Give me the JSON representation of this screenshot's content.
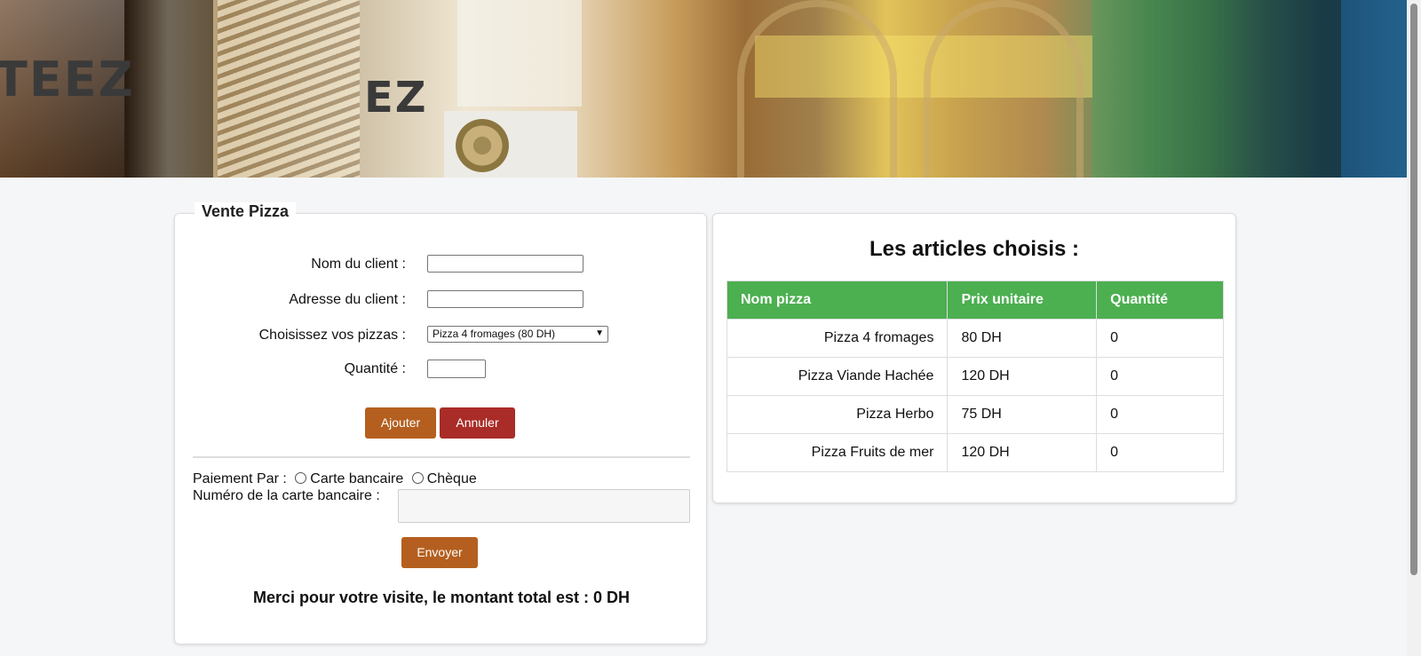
{
  "form": {
    "legend": "Vente Pizza",
    "client_name_label": "Nom du client :",
    "client_name_value": "",
    "client_address_label": "Adresse du client :",
    "client_address_value": "",
    "pizza_select_label": "Choisissez vos pizzas :",
    "pizza_select_value": "Pizza 4 fromages (80 DH)",
    "quantity_label": "Quantité :",
    "quantity_value": "",
    "add_button": "Ajouter",
    "cancel_button": "Annuler",
    "payment_label": "Paiement Par :",
    "payment_options": [
      "Carte bancaire",
      "Chèque"
    ],
    "card_number_label": "Numéro de la carte bancaire :",
    "card_number_value": "",
    "send_button": "Envoyer",
    "total_message": "Merci pour votre visite, le montant total est : 0 DH"
  },
  "articles": {
    "title": "Les articles choisis :",
    "columns": [
      "Nom pizza",
      "Prix unitaire",
      "Quantité"
    ],
    "rows": [
      [
        "Pizza 4 fromages",
        "80 DH",
        "0"
      ],
      [
        "Pizza Viande Hachée",
        "120 DH",
        "0"
      ],
      [
        "Pizza Herbo",
        "75 DH",
        "0"
      ],
      [
        "Pizza Fruits de mer",
        "120 DH",
        "0"
      ]
    ]
  },
  "banner": {
    "sign_text_1": "TEEZ",
    "sign_text_2": "EZ"
  },
  "colors": {
    "table_header": "#4caf50",
    "button_brown": "#b45f1f",
    "button_red": "#a92c28"
  }
}
